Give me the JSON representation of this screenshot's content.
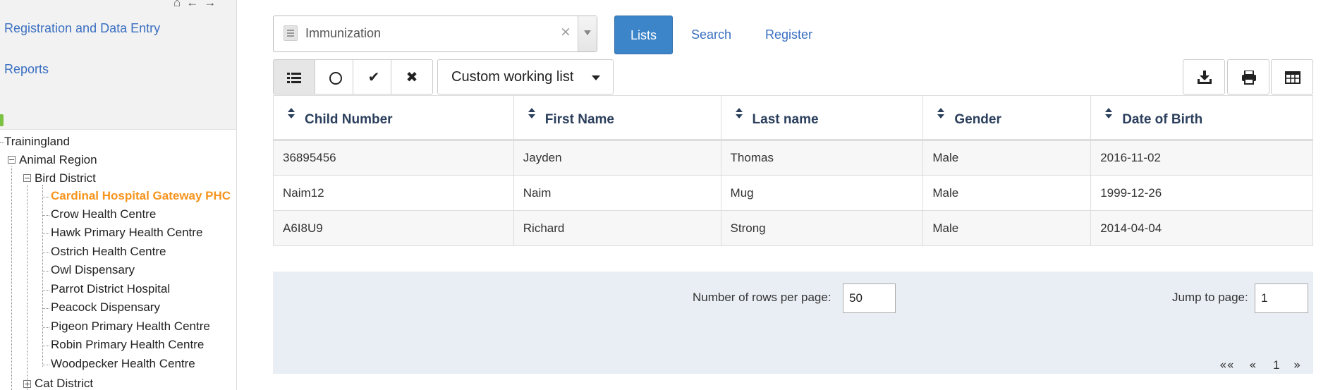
{
  "sidebar": {
    "links": [
      "Registration and Data Entry",
      "Reports"
    ],
    "tree": [
      {
        "label": "Trainingland"
      },
      {
        "label": "Animal Region"
      },
      {
        "label": "Bird District"
      },
      {
        "label": "Cardinal Hospital Gateway PHC"
      },
      {
        "label": "Crow Health Centre"
      },
      {
        "label": "Hawk Primary Health Centre"
      },
      {
        "label": "Ostrich Health Centre"
      },
      {
        "label": "Owl Dispensary"
      },
      {
        "label": "Parrot District Hospital"
      },
      {
        "label": "Peacock Dispensary"
      },
      {
        "label": "Pigeon Primary Health Centre"
      },
      {
        "label": "Robin Primary Health Centre"
      },
      {
        "label": "Woodpecker Health Centre"
      },
      {
        "label": "Cat District"
      }
    ],
    "selected_color": "#f7941d"
  },
  "program_select": {
    "value": "Immunization"
  },
  "tabs": {
    "lists": "Lists",
    "search": "Search",
    "register": "Register",
    "active_color": "#3d85c9"
  },
  "toolbar": {
    "working_list": "Custom working list",
    "filter_icons": [
      "list-icon",
      "circle-icon",
      "check-icon",
      "close-icon"
    ],
    "tool_icons": [
      "download-icon",
      "print-icon",
      "grid-icon"
    ]
  },
  "table": {
    "headers": [
      "Child Number",
      "First Name",
      "Last name",
      "Gender",
      "Date of Birth"
    ],
    "rows": [
      [
        "36895456",
        "Jayden",
        "Thomas",
        "Male",
        "2016-11-02"
      ],
      [
        "Naim12",
        "Naim",
        "Mug",
        "Male",
        "1999-12-26"
      ],
      [
        "A6I8U9",
        "Richard",
        "Strong",
        "Male",
        "2014-04-04"
      ]
    ]
  },
  "pager": {
    "rows_label": "Number of rows per page:",
    "rows_value": "50",
    "jump_label": "Jump to page:",
    "jump_value": "1",
    "first": "««",
    "prev": "«",
    "current": "1",
    "next": "»"
  }
}
